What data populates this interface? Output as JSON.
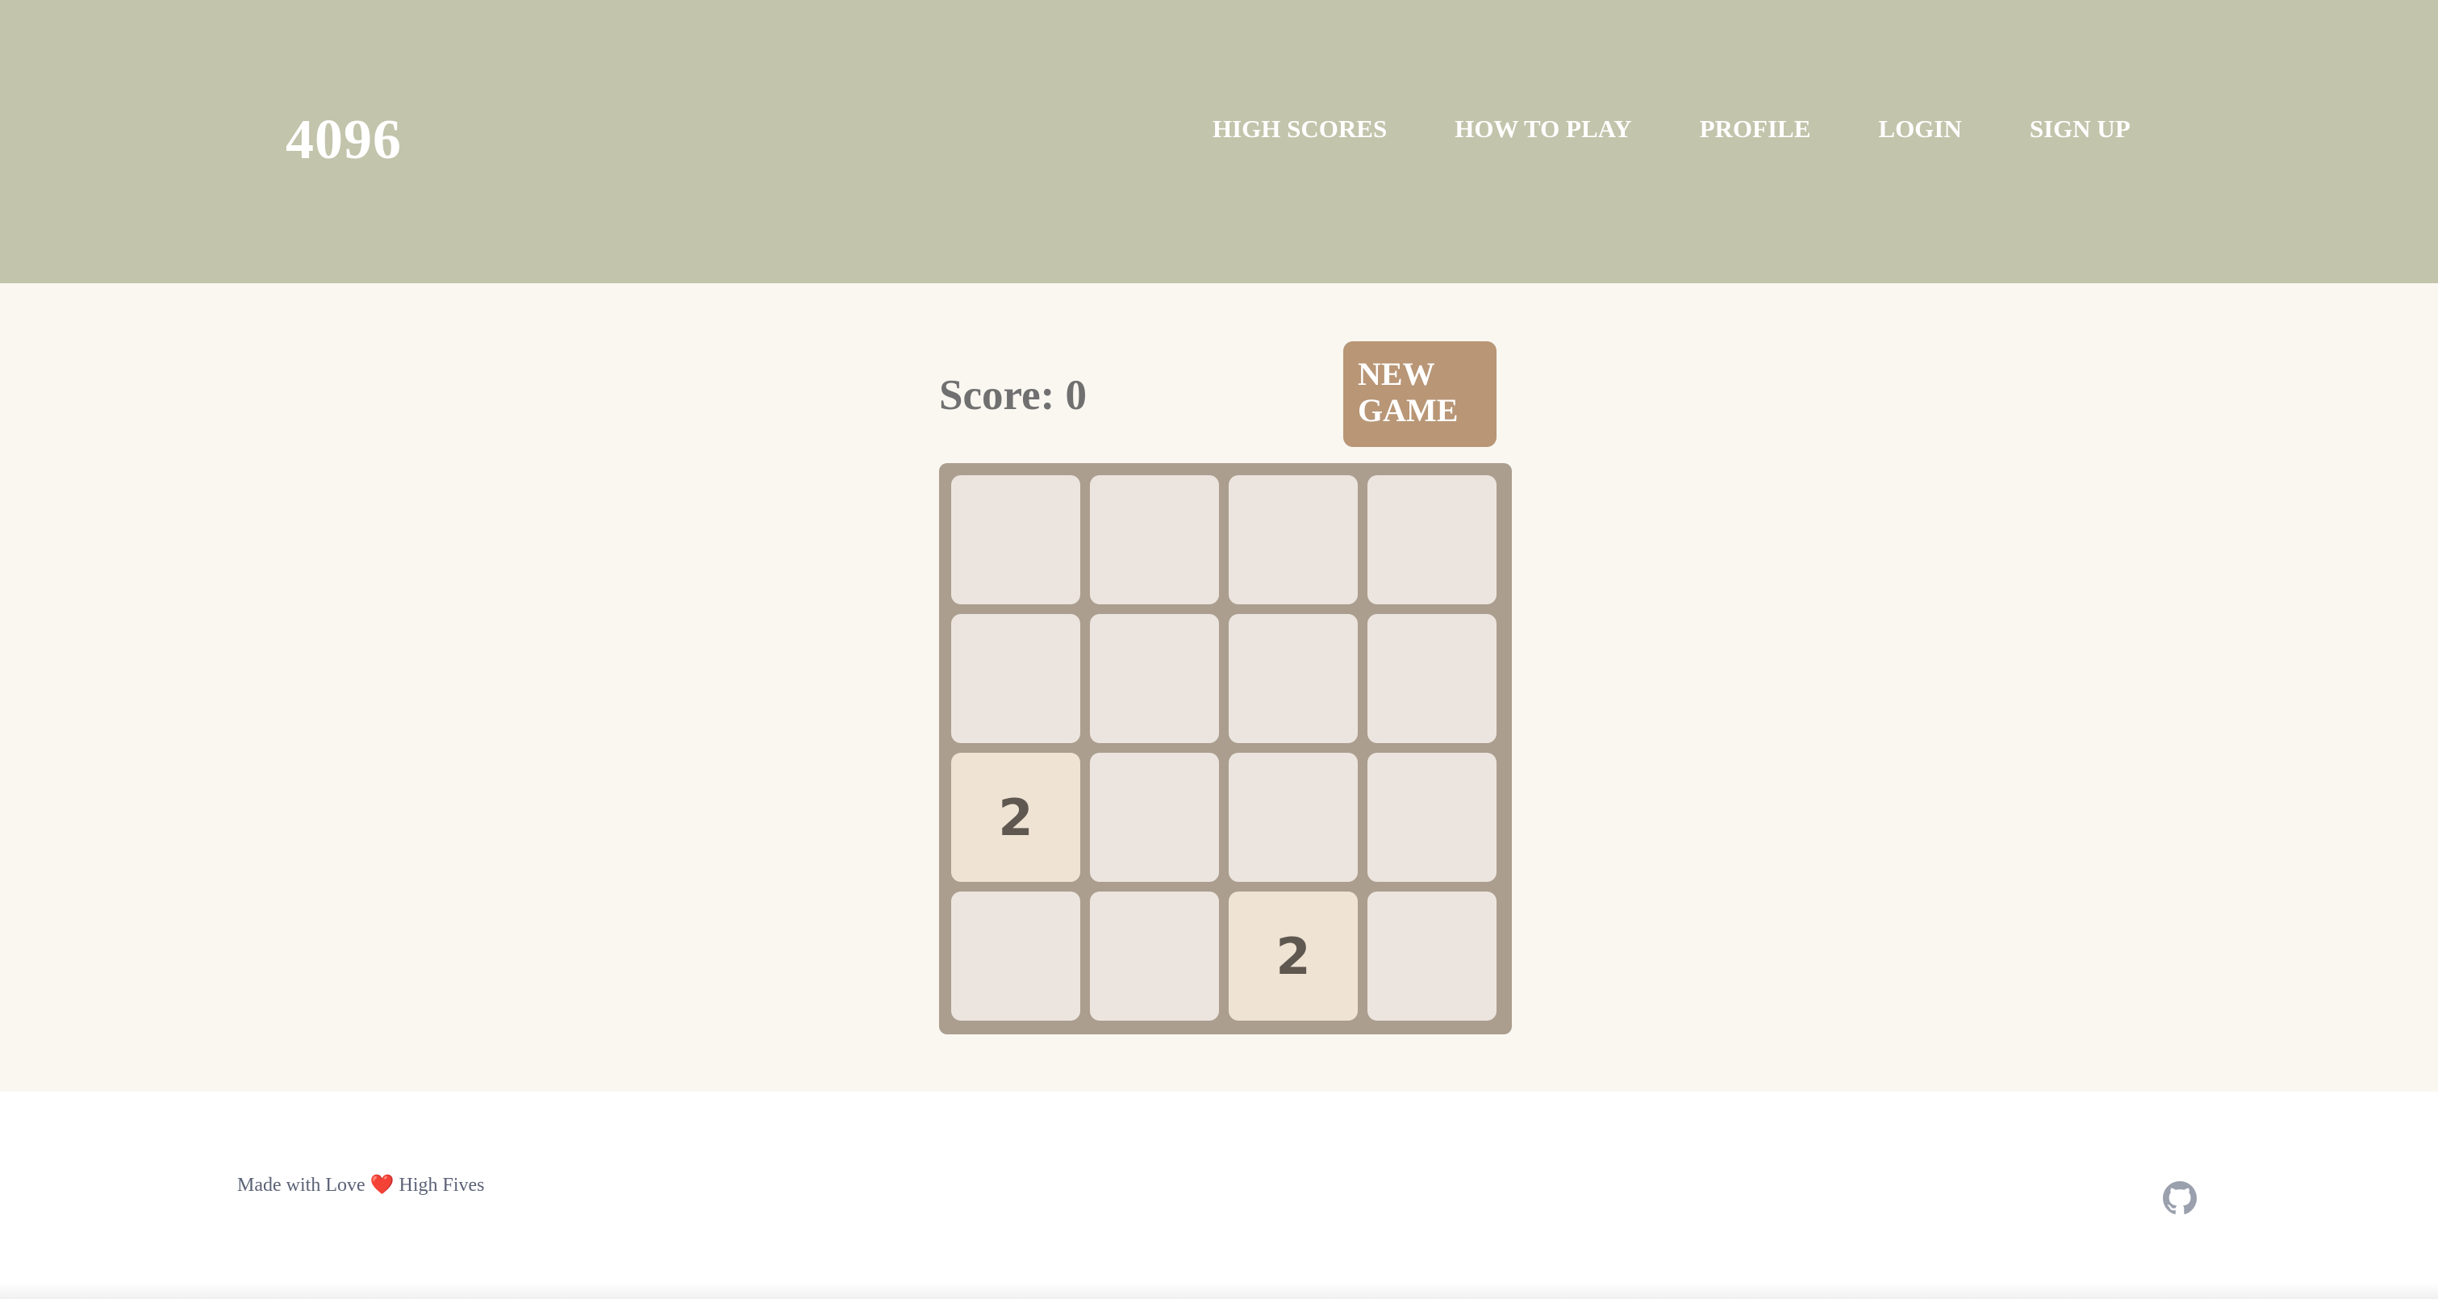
{
  "header": {
    "logo": "4096",
    "nav": [
      "HIGH SCORES",
      "HOW TO PLAY",
      "PROFILE",
      "LOGIN",
      "SIGN UP"
    ]
  },
  "game": {
    "score_text": "Score: 0",
    "new_game_line1": "NEW",
    "new_game_line2": "GAME",
    "board": [
      [
        "",
        "",
        "",
        ""
      ],
      [
        "",
        "",
        "",
        ""
      ],
      [
        "2",
        "",
        "",
        ""
      ],
      [
        "",
        "",
        "2",
        ""
      ]
    ]
  },
  "footer": {
    "text_before": "Made with Love",
    "heart": "❤️",
    "text_after": "High Fives",
    "github_icon": "github-icon"
  },
  "colors": {
    "header_bg": "#c2c4ab",
    "main_bg": "#faf7f1",
    "board_bg": "#ab9e8f",
    "empty_tile": "#ece5df",
    "tile_2": "#efe3d4",
    "new_game_bg": "#b89676"
  }
}
